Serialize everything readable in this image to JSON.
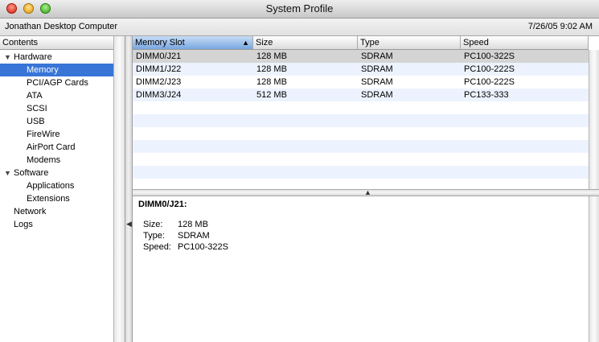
{
  "window": {
    "title": "System Profile"
  },
  "infobar": {
    "computer_name": "Jonathan Desktop Computer",
    "datetime": "7/26/05 9:02 AM"
  },
  "sidebar": {
    "header": "Contents",
    "items": [
      {
        "label": "Hardware",
        "level": 0,
        "expanded": true
      },
      {
        "label": "Memory",
        "level": 1,
        "selected": true
      },
      {
        "label": "PCI/AGP Cards",
        "level": 1
      },
      {
        "label": "ATA",
        "level": 1
      },
      {
        "label": "SCSI",
        "level": 1
      },
      {
        "label": "USB",
        "level": 1
      },
      {
        "label": "FireWire",
        "level": 1
      },
      {
        "label": "AirPort Card",
        "level": 1
      },
      {
        "label": "Modems",
        "level": 1
      },
      {
        "label": "Software",
        "level": 0,
        "expanded": true
      },
      {
        "label": "Applications",
        "level": 1
      },
      {
        "label": "Extensions",
        "level": 1
      },
      {
        "label": "Network",
        "level": 0
      },
      {
        "label": "Logs",
        "level": 0
      }
    ]
  },
  "table": {
    "columns": [
      "Memory Slot",
      "Size",
      "Type",
      "Speed"
    ],
    "sorted_column": "Memory Slot",
    "sort_direction": "ascending",
    "rows": [
      [
        "DIMM0/J21",
        "128 MB",
        "SDRAM",
        "PC100-322S"
      ],
      [
        "DIMM1/J22",
        "128 MB",
        "SDRAM",
        "PC100-222S"
      ],
      [
        "DIMM2/J23",
        "128 MB",
        "SDRAM",
        "PC100-222S"
      ],
      [
        "DIMM3/J24",
        "512 MB",
        "SDRAM",
        "PC133-333"
      ]
    ],
    "selected_row": 0
  },
  "detail": {
    "title": "DIMM0/J21:",
    "fields": [
      {
        "label": "Size:",
        "value": "128 MB"
      },
      {
        "label": "Type:",
        "value": "SDRAM"
      },
      {
        "label": "Speed:",
        "value": "PC100-322S"
      }
    ]
  },
  "colors": {
    "selection": "#3875d7",
    "row_alt": "#edf3fe",
    "row_selected": "#d4d4d4"
  }
}
